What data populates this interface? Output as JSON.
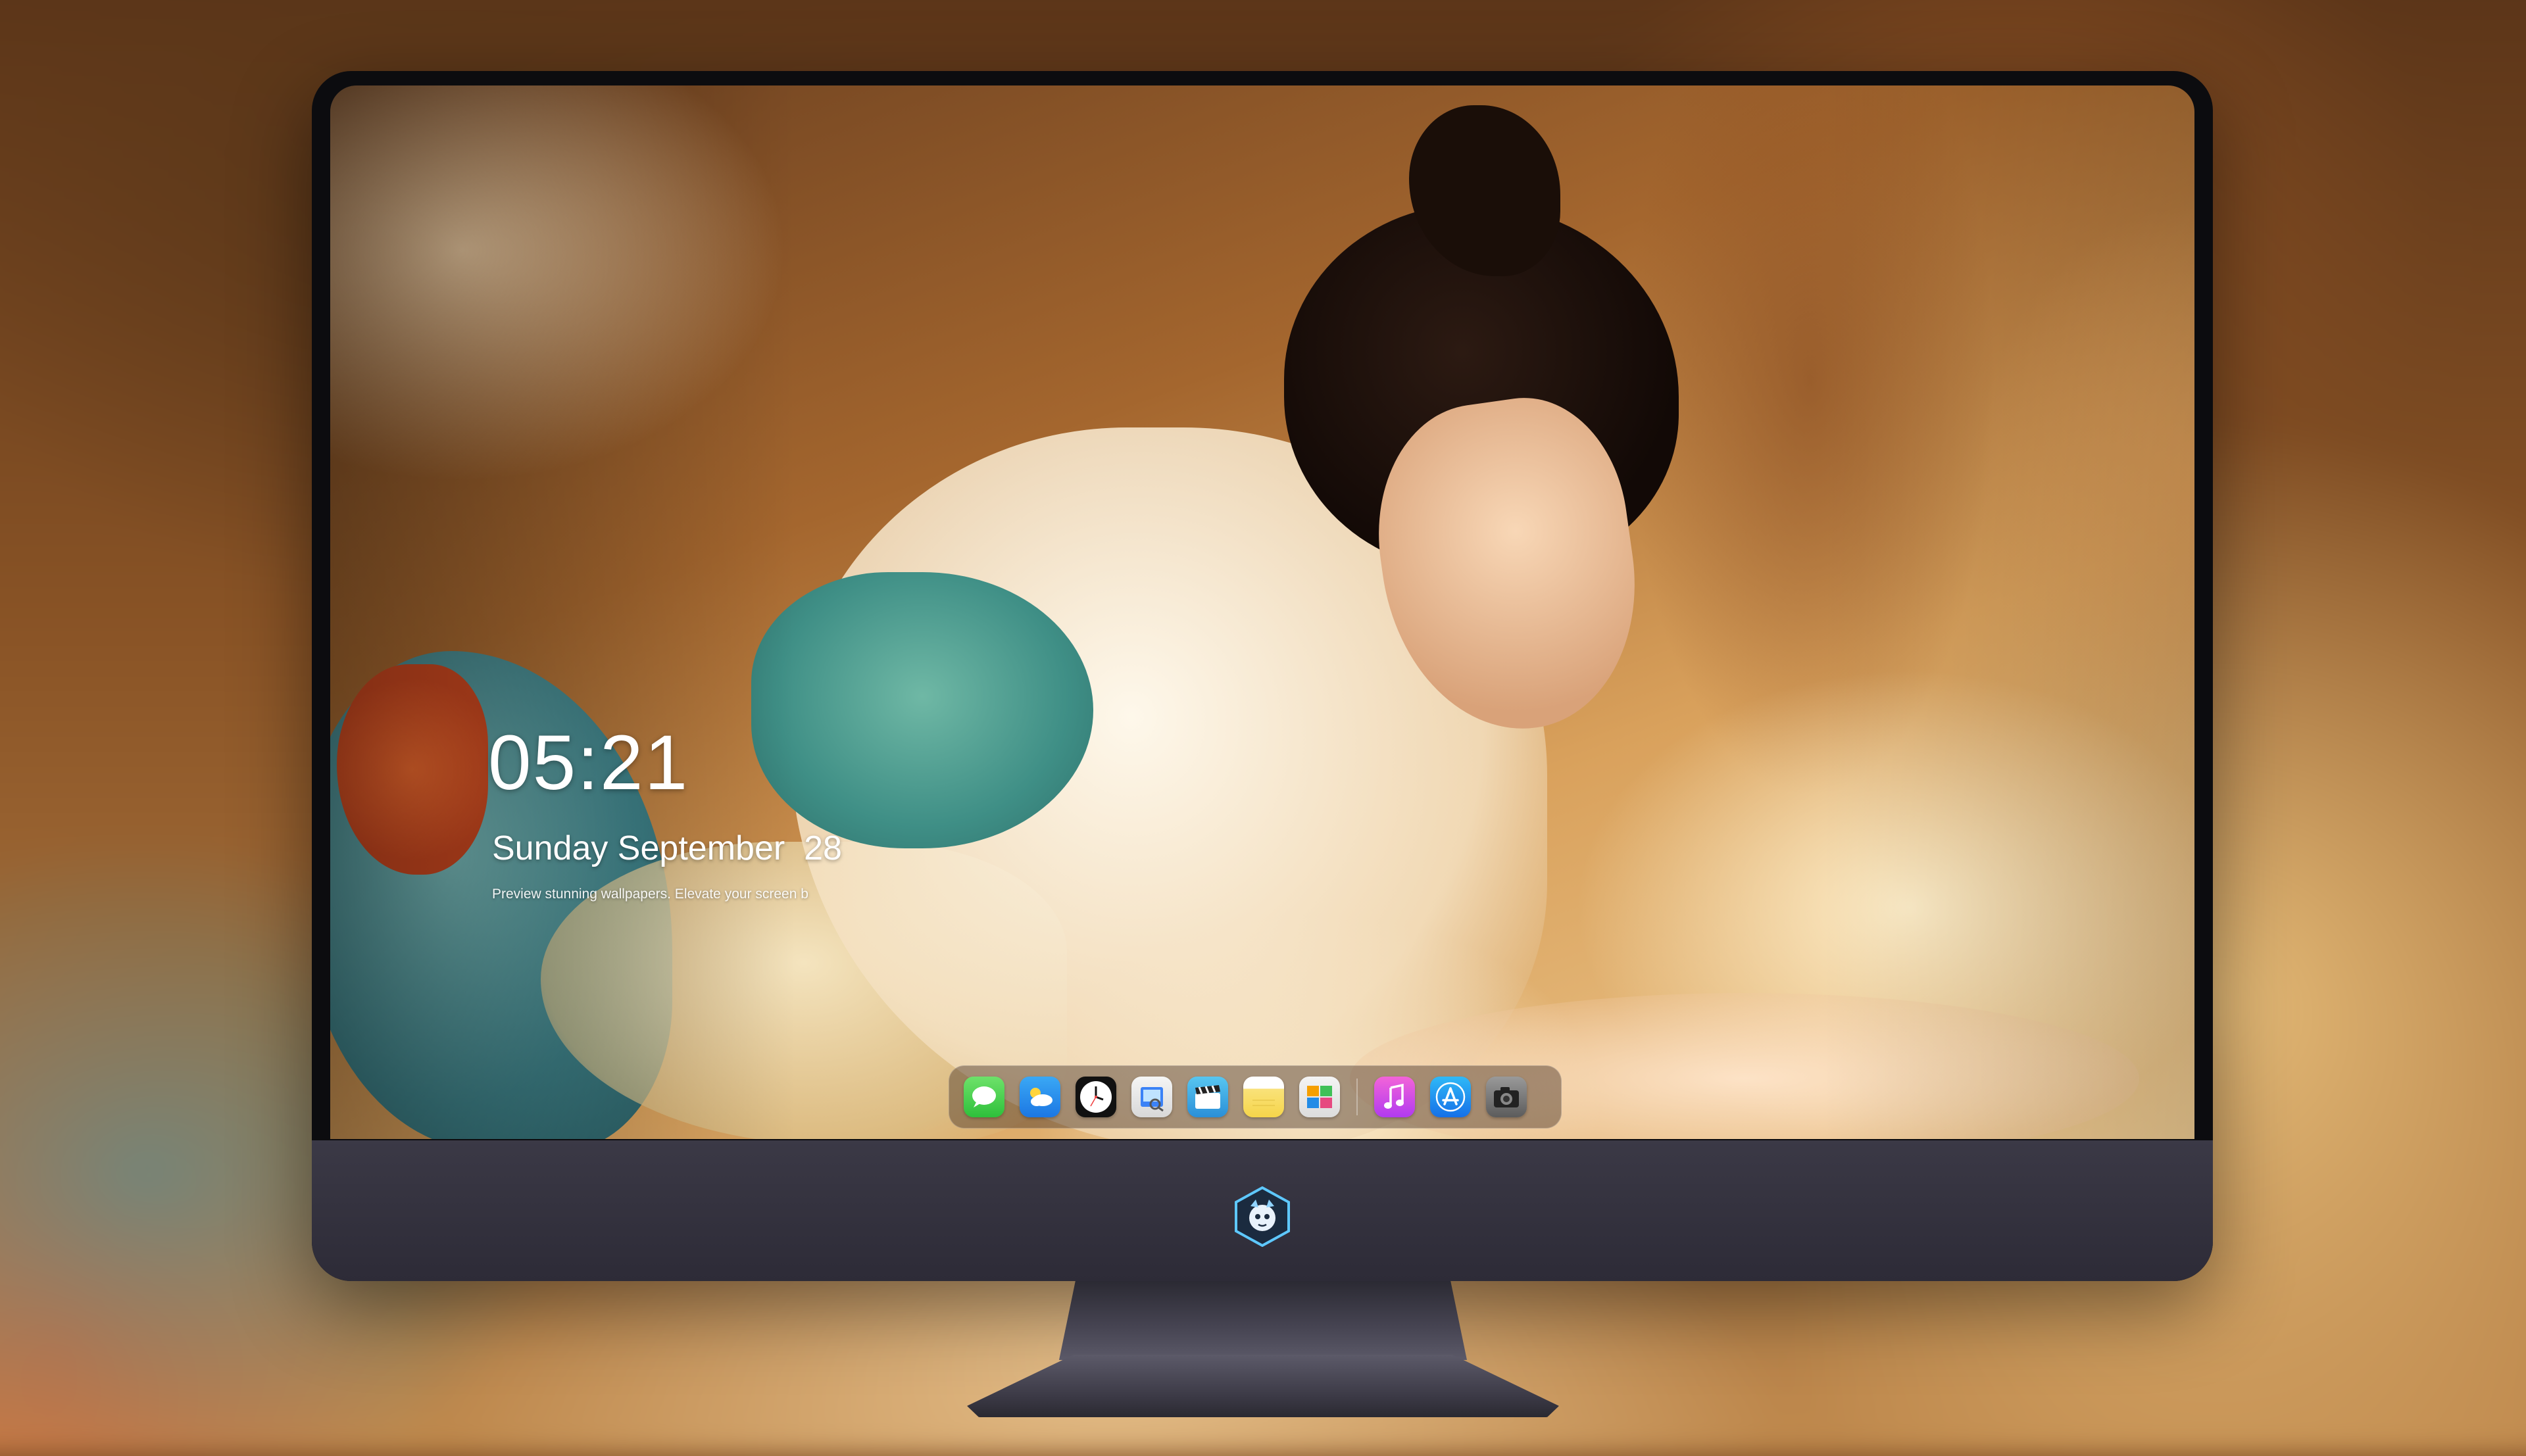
{
  "lockscreen": {
    "time": "05:21",
    "date": "Sunday September  28",
    "tagline": "Preview stunning wallpapers. Elevate your screen b"
  },
  "dock": {
    "apps": [
      {
        "name": "Messages",
        "icon": "messages-icon"
      },
      {
        "name": "Weather",
        "icon": "weather-icon"
      },
      {
        "name": "Clock",
        "icon": "clock-icon"
      },
      {
        "name": "Preview",
        "icon": "preview-icon"
      },
      {
        "name": "Claquette",
        "icon": "claquette-icon"
      },
      {
        "name": "Notes",
        "icon": "notes-icon"
      },
      {
        "name": "Photos",
        "icon": "photos-icon"
      },
      {
        "name": "Music",
        "icon": "music-icon"
      },
      {
        "name": "App Store",
        "icon": "app-store-icon"
      },
      {
        "name": "Camera",
        "icon": "camera-icon"
      }
    ]
  },
  "monitor": {
    "logo": "dragon-mascot-logo"
  },
  "colors": {
    "bezel": "#0c0c0f",
    "chin": "#33313d",
    "dock_bg": "rgba(70,50,40,0.45)",
    "text": "#ffffff"
  }
}
